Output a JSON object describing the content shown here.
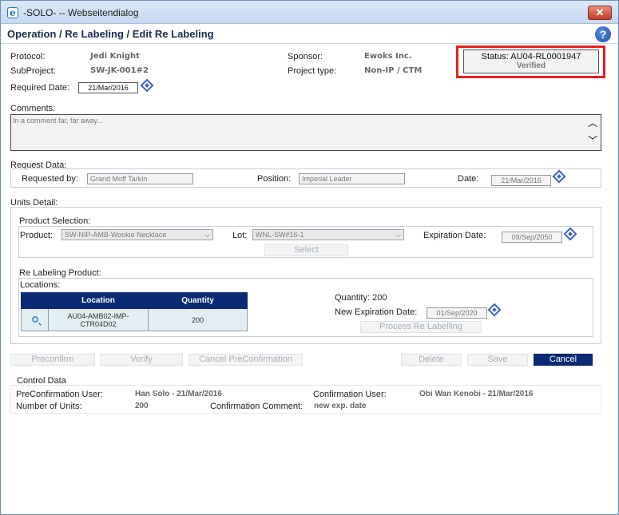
{
  "window": {
    "title": "-SOLO- -- Webseitendialog",
    "close_label": "✕"
  },
  "header": {
    "title": "Operation / Re Labeling / Edit Re Labeling",
    "help_label": "?"
  },
  "info": {
    "protocol_label": "Protocol:",
    "protocol_value": "Jedi Knight",
    "subproject_label": "SubProject:",
    "subproject_value": "SW-JK-001#2",
    "required_date_label": "Required Date:",
    "required_date_value": "21/Mar/2016",
    "sponsor_label": "Sponsor:",
    "sponsor_value": "Ewoks Inc.",
    "project_type_label": "Project type:",
    "project_type_value": "Non-IP / CTM"
  },
  "status": {
    "line1": "Status: AU04-RL0001947",
    "line2": "Verified",
    "highlight_color": "#e62020"
  },
  "comments": {
    "label": "Comments:",
    "value": "In a comment far, far away..."
  },
  "request": {
    "section_label": "Request Data:",
    "requested_by_label": "Requested by:",
    "requested_by_value": "Grand Moff Tarkin",
    "position_label": "Position:",
    "position_value": "Imperial Leader",
    "date_label": "Date:",
    "date_value": "21/Mar/2016"
  },
  "units": {
    "section_label": "Units Detail:",
    "product_selection_label": "Product Selection:",
    "product_label": "Product:",
    "product_value": "SW-NIP-AMB-Wookie Necklace",
    "lot_label": "Lot:",
    "lot_value": "WNL-SW#16-1",
    "expiration_label": "Expiration Date:",
    "expiration_value": "09/Sep/2050",
    "select_button": "Select",
    "relabel_label": "Re Labeling Product:",
    "locations_label": "Locations:",
    "table": {
      "headers": [
        "Location",
        "Quantity"
      ],
      "rows": [
        {
          "location": "AU04-AMB02-IMP-CTR04D02",
          "quantity": "200"
        }
      ]
    },
    "quantity_text": "Quantity: 200",
    "new_expiration_label": "New Expiration Date:",
    "new_expiration_value": "01/Sep/2020",
    "process_button": "Process Re Labelling"
  },
  "actions": {
    "preconfirm": "Preconfirm",
    "verify": "Verify",
    "cancel_preconfirmation": "Cancel PreConfirmation",
    "delete": "Delete",
    "save": "Save",
    "cancel": "Cancel"
  },
  "control": {
    "section_label": "Control Data",
    "preconfirmation_user_label": "PreConfirmation User:",
    "preconfirmation_user_value": "Han Solo - 21/Mar/2016",
    "confirmation_user_label": "Confirmation User:",
    "confirmation_user_value": "Obi Wan Kenobi - 21/Mar/2016",
    "number_of_units_label": "Number of Units:",
    "number_of_units_value": "200",
    "confirmation_comment_label": "Confirmation Comment:",
    "confirmation_comment_value": "new exp. date"
  }
}
